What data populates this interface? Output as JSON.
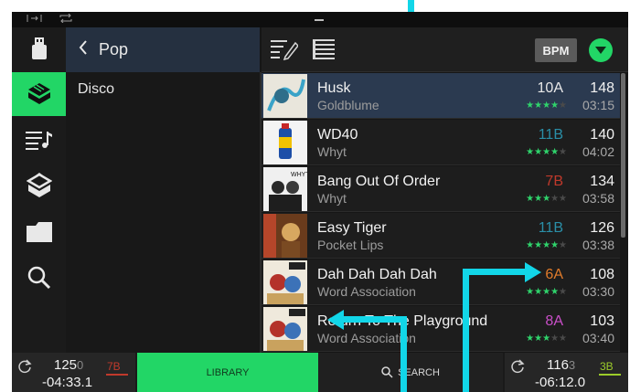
{
  "statusbar": {
    "left_icon_1": "skip-icon",
    "left_icon_2": "repeat-icon"
  },
  "sidebar": {
    "items": [
      {
        "icon": "usb-drive-icon",
        "active": false
      },
      {
        "icon": "crates-icon",
        "active": true
      },
      {
        "icon": "playlist-icon",
        "active": false
      },
      {
        "icon": "prepare-icon",
        "active": false
      },
      {
        "icon": "folder-icon",
        "active": false
      },
      {
        "icon": "search-icon",
        "active": false
      }
    ]
  },
  "breadcrumb": {
    "back_icon": "chevron-left-icon",
    "label": "Pop"
  },
  "folders": {
    "items": [
      "Disco"
    ]
  },
  "toolbar": {
    "edit_icon": "edit-list-icon",
    "list_icon": "list-icon",
    "sort_label": "BPM",
    "sort_dir_icon": "triangle-down-icon"
  },
  "tracks": [
    {
      "title": "Husk",
      "artist": "Goldblume",
      "key": "10A",
      "key_color": "#e8e8e8",
      "bpm": "148",
      "time": "03:15",
      "rating": 4,
      "selected": true
    },
    {
      "title": "WD40",
      "artist": "Whyt",
      "key": "11B",
      "key_color": "#2a8fa8",
      "bpm": "140",
      "time": "04:02",
      "rating": 4,
      "selected": false
    },
    {
      "title": "Bang Out Of Order",
      "artist": "Whyt",
      "key": "7B",
      "key_color": "#c0392b",
      "bpm": "134",
      "time": "03:58",
      "rating": 3,
      "selected": false
    },
    {
      "title": "Easy Tiger",
      "artist": "Pocket Lips",
      "key": "11B",
      "key_color": "#2a8fa8",
      "bpm": "126",
      "time": "03:38",
      "rating": 4,
      "selected": false
    },
    {
      "title": "Dah Dah Dah Dah",
      "artist": "Word Association",
      "key": "6A",
      "key_color": "#e07b2a",
      "bpm": "108",
      "time": "03:30",
      "rating": 4,
      "selected": false
    },
    {
      "title": "Return To The Playground",
      "artist": "Word Association",
      "key": "8A",
      "key_color": "#c94fc8",
      "bpm": "103",
      "time": "03:40",
      "rating": 3,
      "selected": false
    }
  ],
  "bottom": {
    "deck_left": {
      "bpm_main": "125",
      "bpm_dec": "0",
      "key": "7B",
      "key_color": "#c0392b",
      "time": "-04:33.1"
    },
    "library_label": "LIBRARY",
    "search_label": "SEARCH",
    "deck_right": {
      "bpm_main": "116",
      "bpm_dec": "3",
      "key": "3B",
      "key_color": "#9ccc2a",
      "time": "-06:12.0"
    }
  },
  "colors": {
    "accent": "#22d666",
    "selected_row": "#2b3a50",
    "annotation": "#12d6e8"
  }
}
